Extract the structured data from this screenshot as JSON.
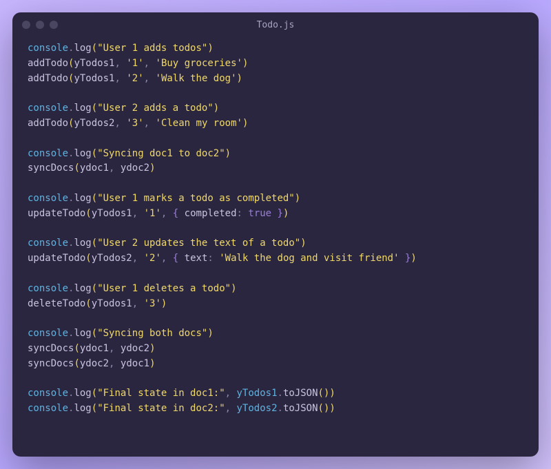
{
  "window": {
    "title": "Todo.js"
  },
  "code": {
    "lines": [
      [
        {
          "t": "console",
          "c": "obj"
        },
        {
          "t": ".",
          "c": "punct"
        },
        {
          "t": "log",
          "c": "method"
        },
        {
          "t": "(",
          "c": "paren"
        },
        {
          "t": "\"User 1 adds todos\"",
          "c": "str"
        },
        {
          "t": ")",
          "c": "paren"
        }
      ],
      [
        {
          "t": "addTodo",
          "c": "fn"
        },
        {
          "t": "(",
          "c": "paren"
        },
        {
          "t": "yTodos1",
          "c": "arg"
        },
        {
          "t": ",",
          "c": "comma"
        },
        {
          "t": " ",
          "c": "arg"
        },
        {
          "t": "'1'",
          "c": "str"
        },
        {
          "t": ",",
          "c": "comma"
        },
        {
          "t": " ",
          "c": "arg"
        },
        {
          "t": "'Buy groceries'",
          "c": "str"
        },
        {
          "t": ")",
          "c": "paren"
        }
      ],
      [
        {
          "t": "addTodo",
          "c": "fn"
        },
        {
          "t": "(",
          "c": "paren"
        },
        {
          "t": "yTodos1",
          "c": "arg"
        },
        {
          "t": ",",
          "c": "comma"
        },
        {
          "t": " ",
          "c": "arg"
        },
        {
          "t": "'2'",
          "c": "str"
        },
        {
          "t": ",",
          "c": "comma"
        },
        {
          "t": " ",
          "c": "arg"
        },
        {
          "t": "'Walk the dog'",
          "c": "str"
        },
        {
          "t": ")",
          "c": "paren"
        }
      ],
      [],
      [
        {
          "t": "console",
          "c": "obj"
        },
        {
          "t": ".",
          "c": "punct"
        },
        {
          "t": "log",
          "c": "method"
        },
        {
          "t": "(",
          "c": "paren"
        },
        {
          "t": "\"User 2 adds a todo\"",
          "c": "str"
        },
        {
          "t": ")",
          "c": "paren"
        }
      ],
      [
        {
          "t": "addTodo",
          "c": "fn"
        },
        {
          "t": "(",
          "c": "paren"
        },
        {
          "t": "yTodos2",
          "c": "arg"
        },
        {
          "t": ",",
          "c": "comma"
        },
        {
          "t": " ",
          "c": "arg"
        },
        {
          "t": "'3'",
          "c": "str"
        },
        {
          "t": ",",
          "c": "comma"
        },
        {
          "t": " ",
          "c": "arg"
        },
        {
          "t": "'Clean my room'",
          "c": "str"
        },
        {
          "t": ")",
          "c": "paren"
        }
      ],
      [],
      [
        {
          "t": "console",
          "c": "obj"
        },
        {
          "t": ".",
          "c": "punct"
        },
        {
          "t": "log",
          "c": "method"
        },
        {
          "t": "(",
          "c": "paren"
        },
        {
          "t": "\"Syncing doc1 to doc2\"",
          "c": "str"
        },
        {
          "t": ")",
          "c": "paren"
        }
      ],
      [
        {
          "t": "syncDocs",
          "c": "fn"
        },
        {
          "t": "(",
          "c": "paren"
        },
        {
          "t": "ydoc1",
          "c": "arg"
        },
        {
          "t": ",",
          "c": "comma"
        },
        {
          "t": " ",
          "c": "arg"
        },
        {
          "t": "ydoc2",
          "c": "arg"
        },
        {
          "t": ")",
          "c": "paren"
        }
      ],
      [],
      [
        {
          "t": "console",
          "c": "obj"
        },
        {
          "t": ".",
          "c": "punct"
        },
        {
          "t": "log",
          "c": "method"
        },
        {
          "t": "(",
          "c": "paren"
        },
        {
          "t": "\"User 1 marks a todo as completed\"",
          "c": "str"
        },
        {
          "t": ")",
          "c": "paren"
        }
      ],
      [
        {
          "t": "updateTodo",
          "c": "fn"
        },
        {
          "t": "(",
          "c": "paren"
        },
        {
          "t": "yTodos1",
          "c": "arg"
        },
        {
          "t": ",",
          "c": "comma"
        },
        {
          "t": " ",
          "c": "arg"
        },
        {
          "t": "'1'",
          "c": "str"
        },
        {
          "t": ",",
          "c": "comma"
        },
        {
          "t": " ",
          "c": "arg"
        },
        {
          "t": "{ ",
          "c": "brace"
        },
        {
          "t": "completed",
          "c": "key"
        },
        {
          "t": ":",
          "c": "colon"
        },
        {
          "t": " ",
          "c": "arg"
        },
        {
          "t": "true",
          "c": "bool"
        },
        {
          "t": " }",
          "c": "brace"
        },
        {
          "t": ")",
          "c": "paren"
        }
      ],
      [],
      [
        {
          "t": "console",
          "c": "obj"
        },
        {
          "t": ".",
          "c": "punct"
        },
        {
          "t": "log",
          "c": "method"
        },
        {
          "t": "(",
          "c": "paren"
        },
        {
          "t": "\"User 2 updates the text of a todo\"",
          "c": "str"
        },
        {
          "t": ")",
          "c": "paren"
        }
      ],
      [
        {
          "t": "updateTodo",
          "c": "fn"
        },
        {
          "t": "(",
          "c": "paren"
        },
        {
          "t": "yTodos2",
          "c": "arg"
        },
        {
          "t": ",",
          "c": "comma"
        },
        {
          "t": " ",
          "c": "arg"
        },
        {
          "t": "'2'",
          "c": "str"
        },
        {
          "t": ",",
          "c": "comma"
        },
        {
          "t": " ",
          "c": "arg"
        },
        {
          "t": "{ ",
          "c": "brace"
        },
        {
          "t": "text",
          "c": "key"
        },
        {
          "t": ":",
          "c": "colon"
        },
        {
          "t": " ",
          "c": "arg"
        },
        {
          "t": "'Walk the dog and visit friend'",
          "c": "str"
        },
        {
          "t": " }",
          "c": "brace"
        },
        {
          "t": ")",
          "c": "paren"
        }
      ],
      [],
      [
        {
          "t": "console",
          "c": "obj"
        },
        {
          "t": ".",
          "c": "punct"
        },
        {
          "t": "log",
          "c": "method"
        },
        {
          "t": "(",
          "c": "paren"
        },
        {
          "t": "\"User 1 deletes a todo\"",
          "c": "str"
        },
        {
          "t": ")",
          "c": "paren"
        }
      ],
      [
        {
          "t": "deleteTodo",
          "c": "fn"
        },
        {
          "t": "(",
          "c": "paren"
        },
        {
          "t": "yTodos1",
          "c": "arg"
        },
        {
          "t": ",",
          "c": "comma"
        },
        {
          "t": " ",
          "c": "arg"
        },
        {
          "t": "'3'",
          "c": "str"
        },
        {
          "t": ")",
          "c": "paren"
        }
      ],
      [],
      [
        {
          "t": "console",
          "c": "obj"
        },
        {
          "t": ".",
          "c": "punct"
        },
        {
          "t": "log",
          "c": "method"
        },
        {
          "t": "(",
          "c": "paren"
        },
        {
          "t": "\"Syncing both docs\"",
          "c": "str"
        },
        {
          "t": ")",
          "c": "paren"
        }
      ],
      [
        {
          "t": "syncDocs",
          "c": "fn"
        },
        {
          "t": "(",
          "c": "paren"
        },
        {
          "t": "ydoc1",
          "c": "arg"
        },
        {
          "t": ",",
          "c": "comma"
        },
        {
          "t": " ",
          "c": "arg"
        },
        {
          "t": "ydoc2",
          "c": "arg"
        },
        {
          "t": ")",
          "c": "paren"
        }
      ],
      [
        {
          "t": "syncDocs",
          "c": "fn"
        },
        {
          "t": "(",
          "c": "paren"
        },
        {
          "t": "ydoc2",
          "c": "arg"
        },
        {
          "t": ",",
          "c": "comma"
        },
        {
          "t": " ",
          "c": "arg"
        },
        {
          "t": "ydoc1",
          "c": "arg"
        },
        {
          "t": ")",
          "c": "paren"
        }
      ],
      [],
      [
        {
          "t": "console",
          "c": "obj"
        },
        {
          "t": ".",
          "c": "punct"
        },
        {
          "t": "log",
          "c": "method"
        },
        {
          "t": "(",
          "c": "paren"
        },
        {
          "t": "\"Final state in doc1:\"",
          "c": "str"
        },
        {
          "t": ",",
          "c": "comma"
        },
        {
          "t": " ",
          "c": "arg"
        },
        {
          "t": "yTodos1",
          "c": "prop"
        },
        {
          "t": ".",
          "c": "punct"
        },
        {
          "t": "toJSON",
          "c": "method"
        },
        {
          "t": "()",
          "c": "paren"
        },
        {
          "t": ")",
          "c": "paren"
        }
      ],
      [
        {
          "t": "console",
          "c": "obj"
        },
        {
          "t": ".",
          "c": "punct"
        },
        {
          "t": "log",
          "c": "method"
        },
        {
          "t": "(",
          "c": "paren"
        },
        {
          "t": "\"Final state in doc2:\"",
          "c": "str"
        },
        {
          "t": ",",
          "c": "comma"
        },
        {
          "t": " ",
          "c": "arg"
        },
        {
          "t": "yTodos2",
          "c": "prop"
        },
        {
          "t": ".",
          "c": "punct"
        },
        {
          "t": "toJSON",
          "c": "method"
        },
        {
          "t": "()",
          "c": "paren"
        },
        {
          "t": ")",
          "c": "paren"
        }
      ]
    ]
  }
}
